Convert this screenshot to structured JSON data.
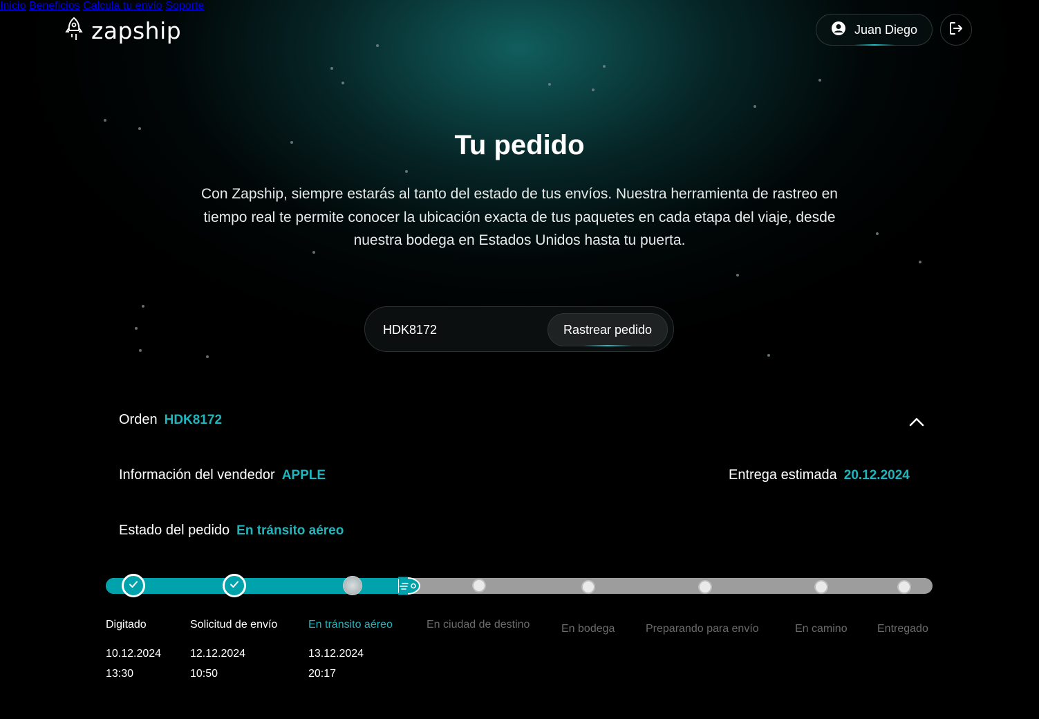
{
  "brand": {
    "name": "zapship"
  },
  "nav": {
    "items": [
      {
        "label": "Inicio"
      },
      {
        "label": "Beneficios"
      },
      {
        "label": "Calcula tu envío"
      },
      {
        "label": "Soporte"
      }
    ],
    "user_name": "Juan Diego"
  },
  "hero": {
    "title": "Tu pedido",
    "subtitle": "Con Zapship, siempre estarás al tanto del estado de tus envíos. Nuestra herramienta de rastreo en tiempo real te permite conocer la ubicación exacta de tus paquetes en cada etapa del viaje, desde nuestra bodega en Estados Unidos hasta tu puerta."
  },
  "search": {
    "value": "HDK8172",
    "button_label": "Rastrear pedido"
  },
  "order": {
    "order_label": "Orden",
    "order_id": "HDK8172",
    "seller_label": "Información del vendedor",
    "seller": "APPLE",
    "delivery_label": "Entrega estimada",
    "delivery_date": "20.12.2024",
    "status_label": "Estado del pedido",
    "status": "En tránsito aéreo"
  },
  "tracking": {
    "steps": [
      {
        "label": "Digitado",
        "state": "done",
        "date": "10.12.2024",
        "time": "13:30"
      },
      {
        "label": "Solicitud de envío",
        "state": "done",
        "date": "12.12.2024",
        "time": "10:50"
      },
      {
        "label": "En tránsito aéreo",
        "state": "current",
        "date": "13.12.2024",
        "time": "20:17"
      },
      {
        "label": "En ciudad de destino",
        "state": "pending"
      },
      {
        "label": "En bodega",
        "state": "pending"
      },
      {
        "label": "Preparando para envío",
        "state": "pending"
      },
      {
        "label": "En camino",
        "state": "pending"
      },
      {
        "label": "Entregado",
        "state": "pending"
      }
    ]
  },
  "colors": {
    "accent": "#00a3ac",
    "accent_text": "#1fb5bd",
    "pending_track": "#9d9d9d",
    "background": "#000000"
  }
}
